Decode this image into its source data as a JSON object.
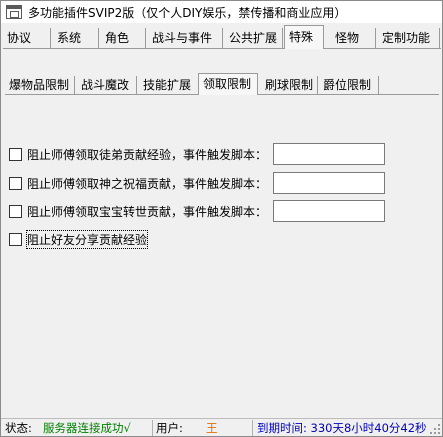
{
  "window": {
    "title": "多功能插件SVIP2版（仅个人DIY娱乐，禁传播和商业应用）"
  },
  "main_tabs": [
    {
      "label": "协议",
      "active": false
    },
    {
      "label": "系统",
      "active": false
    },
    {
      "label": "角色",
      "active": false
    },
    {
      "label": "战斗与事件",
      "active": false
    },
    {
      "label": "公共扩展",
      "active": false
    },
    {
      "label": "特殊",
      "active": true
    },
    {
      "label": "怪物",
      "active": false
    },
    {
      "label": "定制功能",
      "active": false
    }
  ],
  "sub_tabs": [
    {
      "label": "爆物品限制",
      "active": false
    },
    {
      "label": "战斗魔改",
      "active": false
    },
    {
      "label": "技能扩展",
      "active": false
    },
    {
      "label": "领取限制",
      "active": true
    },
    {
      "label": "刷球限制",
      "active": false
    },
    {
      "label": "爵位限制",
      "active": false
    }
  ],
  "options": [
    {
      "label": "阻止师傅领取徒弟贡献经验，事件触发脚本：",
      "checked": false,
      "script_value": ""
    },
    {
      "label": "阻止师傅领取神之祝福贡献，事件触发脚本：",
      "checked": false,
      "script_value": ""
    },
    {
      "label": "阻止师傅领取宝宝转世贡献，事件触发脚本：",
      "checked": false,
      "script_value": ""
    },
    {
      "label": "阻止好友分享贡献经验",
      "checked": false
    }
  ],
  "statusbar": {
    "status_label": "状态:",
    "status_value": "服务器连接成功√",
    "status_color": "#008000",
    "user_label": "用户:",
    "user_value": "王",
    "user_color": "#e07000",
    "expire_text": "到期时间: 330天8小时40分42秒",
    "expire_color": "#0000c0"
  }
}
